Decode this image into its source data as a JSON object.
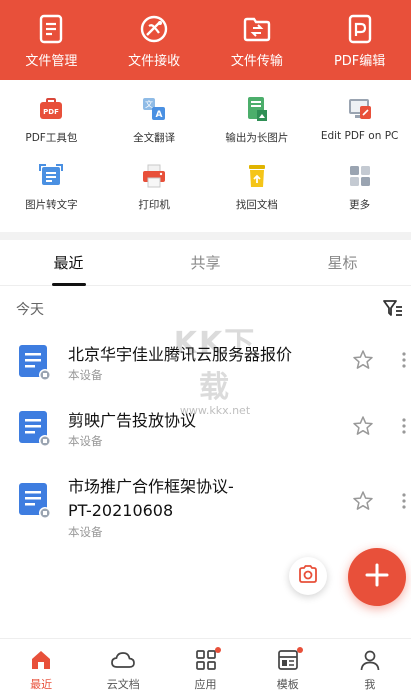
{
  "topbar": {
    "items": [
      {
        "label": "文件管理",
        "icon": "file-manage-icon"
      },
      {
        "label": "文件接收",
        "icon": "satellite-receive-icon"
      },
      {
        "label": "文件传输",
        "icon": "folder-transfer-icon"
      },
      {
        "label": "PDF编辑",
        "icon": "pdf-edit-icon"
      }
    ],
    "color": "#e8503a"
  },
  "tools": {
    "row1": [
      {
        "label": "PDF工具包",
        "icon": "pdf-toolbox-icon"
      },
      {
        "label": "全文翻译",
        "icon": "translate-icon"
      },
      {
        "label": "输出为长图片",
        "icon": "long-image-icon"
      },
      {
        "label": "Edit PDF on PC",
        "icon": "pc-pdf-edit-icon"
      }
    ],
    "row2": [
      {
        "label": "图片转文字",
        "icon": "image-to-text-icon"
      },
      {
        "label": "打印机",
        "icon": "printer-icon"
      },
      {
        "label": "找回文档",
        "icon": "recover-trash-icon"
      },
      {
        "label": "更多",
        "icon": "more-grid-icon"
      }
    ]
  },
  "tabs": [
    {
      "label": "最近",
      "active": true
    },
    {
      "label": "共享",
      "active": false
    },
    {
      "label": "星标",
      "active": false
    }
  ],
  "section": {
    "title": "今天"
  },
  "files": [
    {
      "name": "北京华宇佳业腾讯云服务器报价",
      "location": "本设备"
    },
    {
      "name": "剪映广告投放协议",
      "location": "本设备"
    },
    {
      "name": "市场推广合作框架协议-PT-20210608",
      "location": "本设备"
    }
  ],
  "watermark": {
    "text": "KK下载",
    "url": "www.kkx.net"
  },
  "bottom_nav": [
    {
      "label": "最近",
      "icon": "home-icon",
      "active": true,
      "dot": false
    },
    {
      "label": "云文档",
      "icon": "cloud-icon",
      "active": false,
      "dot": false
    },
    {
      "label": "应用",
      "icon": "apps-grid-icon",
      "active": false,
      "dot": true
    },
    {
      "label": "模板",
      "icon": "template-icon",
      "active": false,
      "dot": true
    },
    {
      "label": "我",
      "icon": "user-icon",
      "active": false,
      "dot": false
    }
  ]
}
